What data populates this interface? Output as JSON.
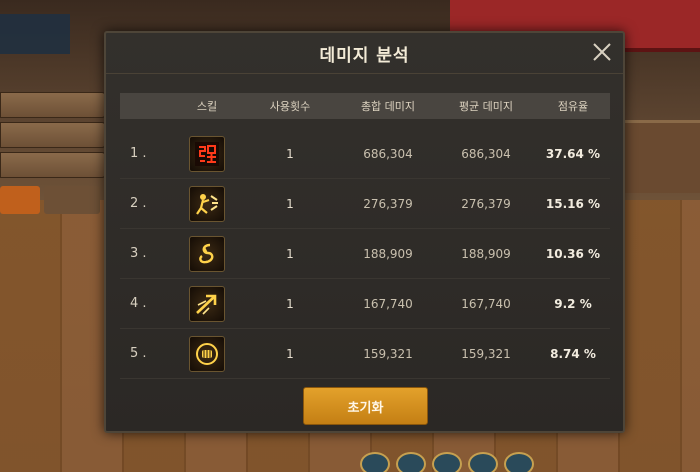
{
  "dialog": {
    "title": "데미지 분석",
    "close_icon": "close-icon",
    "columns": {
      "skill": "스킬",
      "uses": "사용횟수",
      "total": "총합 데미지",
      "average": "평균 데미지",
      "share": "점유율"
    },
    "rows": [
      {
        "rank": "1 .",
        "icon": "strength-glyph-icon",
        "uses": "1",
        "total": "686,304",
        "average": "686,304",
        "share": "37.64 %"
      },
      {
        "rank": "2 .",
        "icon": "strike-impact-icon",
        "uses": "1",
        "total": "276,379",
        "average": "276,379",
        "share": "15.16 %"
      },
      {
        "rank": "3 .",
        "icon": "swirl-icon",
        "uses": "1",
        "total": "188,909",
        "average": "188,909",
        "share": "10.36 %"
      },
      {
        "rank": "4 .",
        "icon": "arrow-slash-icon",
        "uses": "1",
        "total": "167,740",
        "average": "167,740",
        "share": "9.2 %"
      },
      {
        "rank": "5 .",
        "icon": "fist-burst-icon",
        "uses": "1",
        "total": "159,321",
        "average": "159,321",
        "share": "8.74 %"
      }
    ],
    "reset_label": "초기화",
    "accent": "#e3a12b"
  }
}
